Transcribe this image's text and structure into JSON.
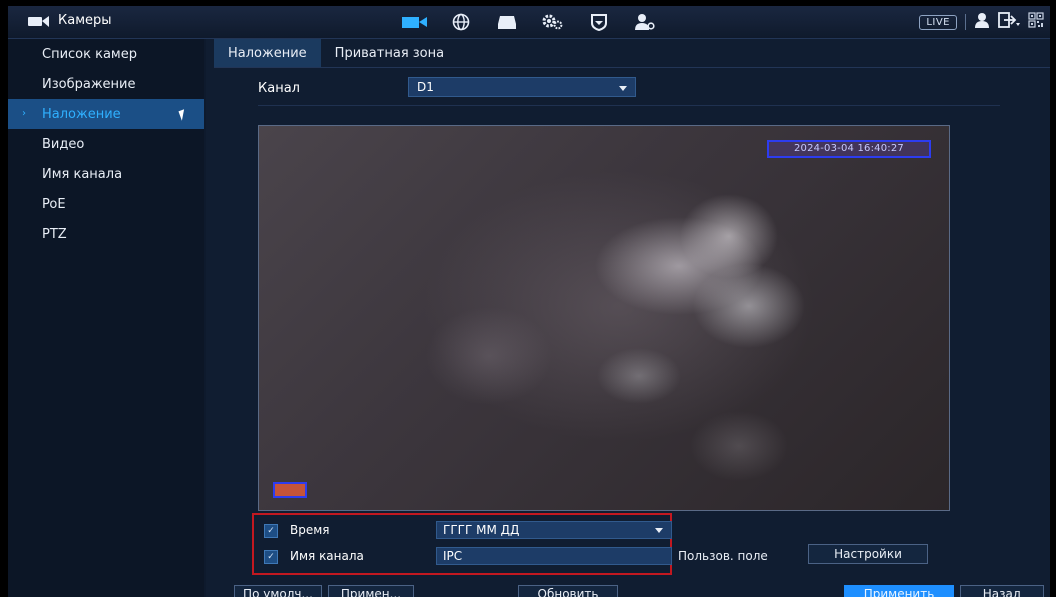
{
  "topbar": {
    "title": "Камеры",
    "icons": [
      "camera-icon",
      "network-icon",
      "storage-icon",
      "settings-icon",
      "security-icon",
      "account-icon"
    ],
    "live_label": "LIVE",
    "right_icons": [
      "user-icon",
      "logout-icon",
      "qr-icon"
    ]
  },
  "sidebar": {
    "items": [
      {
        "label": "Список камер"
      },
      {
        "label": "Изображение"
      },
      {
        "label": "Наложение"
      },
      {
        "label": "Видео"
      },
      {
        "label": "Имя канала"
      },
      {
        "label": "PoE"
      },
      {
        "label": "PTZ"
      }
    ],
    "active_index": 2
  },
  "tabs": [
    {
      "label": "Наложение"
    },
    {
      "label": "Приватная зона"
    }
  ],
  "channel": {
    "label": "Канал",
    "value": "D1"
  },
  "preview": {
    "timestamp": "2024-03-04 16:40:27"
  },
  "options": {
    "time": {
      "label": "Время",
      "value": "ГГГГ ММ ДД",
      "checked": true
    },
    "channel_name": {
      "label": "Имя канала",
      "value": "IPC",
      "checked": true
    }
  },
  "custom": {
    "label": "Пользов. поле",
    "settings_button": "Настройки"
  },
  "footer": {
    "default_button": "По умолч...",
    "apply_short_button": "Примен...",
    "refresh_button": "Обновить",
    "apply_button": "Применить",
    "back_button": "Назад"
  },
  "colors": {
    "accent": "#2fb0ff",
    "active_bg": "#1b4f86",
    "primary_button": "#1e8fff",
    "highlight_border": "#c21820",
    "osd_box": "#2d3cf0"
  }
}
